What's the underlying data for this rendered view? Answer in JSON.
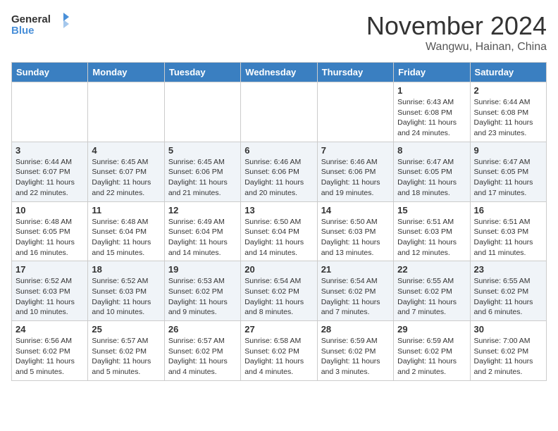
{
  "logo": {
    "text_general": "General",
    "text_blue": "Blue"
  },
  "title": "November 2024",
  "location": "Wangwu, Hainan, China",
  "days_of_week": [
    "Sunday",
    "Monday",
    "Tuesday",
    "Wednesday",
    "Thursday",
    "Friday",
    "Saturday"
  ],
  "weeks": [
    [
      {
        "day": "",
        "info": ""
      },
      {
        "day": "",
        "info": ""
      },
      {
        "day": "",
        "info": ""
      },
      {
        "day": "",
        "info": ""
      },
      {
        "day": "",
        "info": ""
      },
      {
        "day": "1",
        "info": "Sunrise: 6:43 AM\nSunset: 6:08 PM\nDaylight: 11 hours and 24 minutes."
      },
      {
        "day": "2",
        "info": "Sunrise: 6:44 AM\nSunset: 6:08 PM\nDaylight: 11 hours and 23 minutes."
      }
    ],
    [
      {
        "day": "3",
        "info": "Sunrise: 6:44 AM\nSunset: 6:07 PM\nDaylight: 11 hours and 22 minutes."
      },
      {
        "day": "4",
        "info": "Sunrise: 6:45 AM\nSunset: 6:07 PM\nDaylight: 11 hours and 22 minutes."
      },
      {
        "day": "5",
        "info": "Sunrise: 6:45 AM\nSunset: 6:06 PM\nDaylight: 11 hours and 21 minutes."
      },
      {
        "day": "6",
        "info": "Sunrise: 6:46 AM\nSunset: 6:06 PM\nDaylight: 11 hours and 20 minutes."
      },
      {
        "day": "7",
        "info": "Sunrise: 6:46 AM\nSunset: 6:06 PM\nDaylight: 11 hours and 19 minutes."
      },
      {
        "day": "8",
        "info": "Sunrise: 6:47 AM\nSunset: 6:05 PM\nDaylight: 11 hours and 18 minutes."
      },
      {
        "day": "9",
        "info": "Sunrise: 6:47 AM\nSunset: 6:05 PM\nDaylight: 11 hours and 17 minutes."
      }
    ],
    [
      {
        "day": "10",
        "info": "Sunrise: 6:48 AM\nSunset: 6:05 PM\nDaylight: 11 hours and 16 minutes."
      },
      {
        "day": "11",
        "info": "Sunrise: 6:48 AM\nSunset: 6:04 PM\nDaylight: 11 hours and 15 minutes."
      },
      {
        "day": "12",
        "info": "Sunrise: 6:49 AM\nSunset: 6:04 PM\nDaylight: 11 hours and 14 minutes."
      },
      {
        "day": "13",
        "info": "Sunrise: 6:50 AM\nSunset: 6:04 PM\nDaylight: 11 hours and 14 minutes."
      },
      {
        "day": "14",
        "info": "Sunrise: 6:50 AM\nSunset: 6:03 PM\nDaylight: 11 hours and 13 minutes."
      },
      {
        "day": "15",
        "info": "Sunrise: 6:51 AM\nSunset: 6:03 PM\nDaylight: 11 hours and 12 minutes."
      },
      {
        "day": "16",
        "info": "Sunrise: 6:51 AM\nSunset: 6:03 PM\nDaylight: 11 hours and 11 minutes."
      }
    ],
    [
      {
        "day": "17",
        "info": "Sunrise: 6:52 AM\nSunset: 6:03 PM\nDaylight: 11 hours and 10 minutes."
      },
      {
        "day": "18",
        "info": "Sunrise: 6:52 AM\nSunset: 6:03 PM\nDaylight: 11 hours and 10 minutes."
      },
      {
        "day": "19",
        "info": "Sunrise: 6:53 AM\nSunset: 6:02 PM\nDaylight: 11 hours and 9 minutes."
      },
      {
        "day": "20",
        "info": "Sunrise: 6:54 AM\nSunset: 6:02 PM\nDaylight: 11 hours and 8 minutes."
      },
      {
        "day": "21",
        "info": "Sunrise: 6:54 AM\nSunset: 6:02 PM\nDaylight: 11 hours and 7 minutes."
      },
      {
        "day": "22",
        "info": "Sunrise: 6:55 AM\nSunset: 6:02 PM\nDaylight: 11 hours and 7 minutes."
      },
      {
        "day": "23",
        "info": "Sunrise: 6:55 AM\nSunset: 6:02 PM\nDaylight: 11 hours and 6 minutes."
      }
    ],
    [
      {
        "day": "24",
        "info": "Sunrise: 6:56 AM\nSunset: 6:02 PM\nDaylight: 11 hours and 5 minutes."
      },
      {
        "day": "25",
        "info": "Sunrise: 6:57 AM\nSunset: 6:02 PM\nDaylight: 11 hours and 5 minutes."
      },
      {
        "day": "26",
        "info": "Sunrise: 6:57 AM\nSunset: 6:02 PM\nDaylight: 11 hours and 4 minutes."
      },
      {
        "day": "27",
        "info": "Sunrise: 6:58 AM\nSunset: 6:02 PM\nDaylight: 11 hours and 4 minutes."
      },
      {
        "day": "28",
        "info": "Sunrise: 6:59 AM\nSunset: 6:02 PM\nDaylight: 11 hours and 3 minutes."
      },
      {
        "day": "29",
        "info": "Sunrise: 6:59 AM\nSunset: 6:02 PM\nDaylight: 11 hours and 2 minutes."
      },
      {
        "day": "30",
        "info": "Sunrise: 7:00 AM\nSunset: 6:02 PM\nDaylight: 11 hours and 2 minutes."
      }
    ]
  ]
}
